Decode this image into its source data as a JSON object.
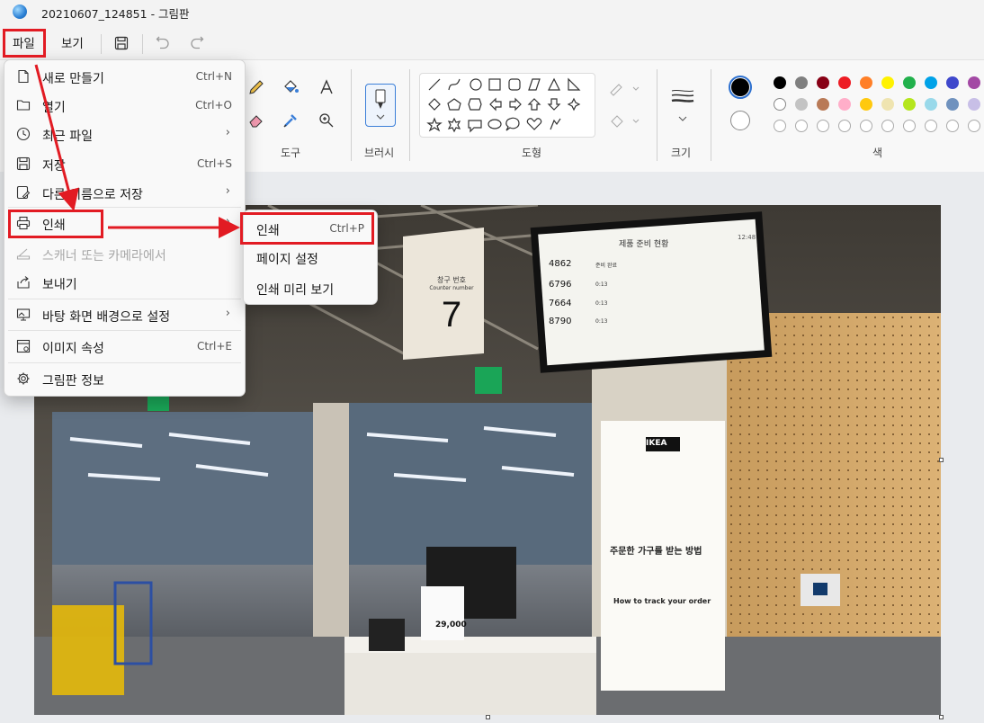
{
  "window": {
    "title": "20210607_124851 - 그림판"
  },
  "menubar": {
    "file": "파일",
    "view": "보기"
  },
  "ribbon": {
    "groups": {
      "tools": "도구",
      "brushes": "브러시",
      "shapes": "도형",
      "size": "크기",
      "colors": "색"
    },
    "colors": {
      "row1": [
        "#000000",
        "#7f7f7f",
        "#880015",
        "#ed1c24",
        "#ff7f27",
        "#fff200",
        "#22b14c",
        "#00a2e8",
        "#3f48cc",
        "#a349a4"
      ],
      "row2": [
        "#ffffff",
        "#c3c3c3",
        "#b97a57",
        "#ffaec9",
        "#ffc90e",
        "#efe4b0",
        "#b5e61d",
        "#99d9ea",
        "#7092be",
        "#c8bfe7"
      ]
    }
  },
  "file_menu": {
    "items": [
      {
        "label": "새로 만들기",
        "shortcut": "Ctrl+N",
        "icon": "new-file-icon"
      },
      {
        "label": "열기",
        "shortcut": "Ctrl+O",
        "icon": "folder-icon"
      },
      {
        "label": "최근 파일",
        "icon": "clock-icon",
        "submenu": true
      },
      {
        "label": "저장",
        "shortcut": "Ctrl+S",
        "icon": "save-icon"
      },
      {
        "label": "다른 이름으로 저장",
        "icon": "save-as-icon",
        "submenu": true
      },
      {
        "label": "인쇄",
        "icon": "printer-icon",
        "submenu": true
      },
      {
        "label": "스캐너 또는 카메라에서",
        "icon": "scanner-icon",
        "disabled": true
      },
      {
        "label": "보내기",
        "icon": "share-icon"
      },
      {
        "label": "바탕 화면 배경으로 설정",
        "icon": "desktop-icon",
        "submenu": true
      },
      {
        "label": "이미지 속성",
        "shortcut": "Ctrl+E",
        "icon": "properties-icon"
      },
      {
        "label": "그림판 정보",
        "icon": "gear-icon"
      }
    ]
  },
  "print_submenu": {
    "items": [
      {
        "label": "인쇄",
        "shortcut": "Ctrl+P"
      },
      {
        "label": "페이지 설정"
      },
      {
        "label": "인쇄 미리 보기"
      }
    ]
  },
  "photo": {
    "counter_sign": {
      "title": "창구 번호",
      "subtitle": "Counter number",
      "number": "7"
    },
    "monitor": {
      "title": "제품 준비 현황",
      "time": "12:48",
      "rows": [
        {
          "order": "4862",
          "status": "준비 완료"
        },
        {
          "order": "6796",
          "status": "0:13"
        },
        {
          "order": "7664",
          "status": "0:13"
        },
        {
          "order": "8790",
          "status": "0:13"
        }
      ]
    },
    "poster": {
      "brand": "IKEA",
      "heading": "주문한 가구를 받는 방법",
      "subheading": "How to track your order"
    },
    "price_sign": {
      "price": "29,000"
    }
  }
}
